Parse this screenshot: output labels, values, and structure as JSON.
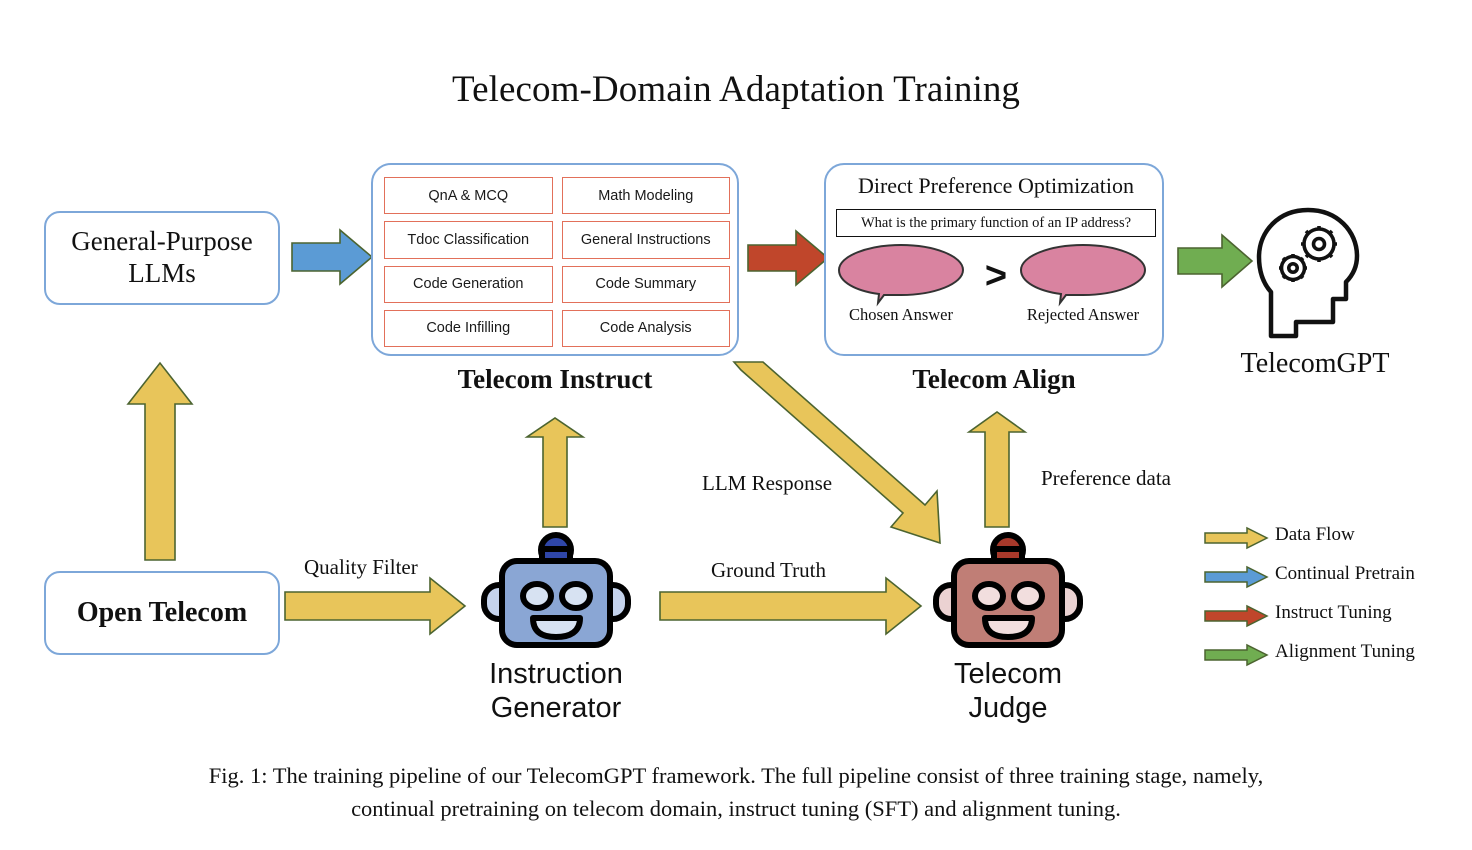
{
  "figure": {
    "title": "Telecom-Domain Adaptation Training",
    "caption_line1": "Fig. 1: The training pipeline of our TelecomGPT framework. The full pipeline consist of three training stage, namely,",
    "caption_line2": "continual pretraining on telecom domain, instruct tuning (SFT) and alignment tuning."
  },
  "nodes": {
    "general_purpose_llms_line1": "General-Purpose",
    "general_purpose_llms_line2": "LLMs",
    "open_telecom": "Open Telecom",
    "telecomgpt_label": "TelecomGPT",
    "instruction_generator_line1": "Instruction",
    "instruction_generator_line2": "Generator",
    "telecom_judge_line1": "Telecom",
    "telecom_judge_line2": "Judge"
  },
  "stages": {
    "instruct_caption": "Telecom Instruct",
    "align_caption": "Telecom Align"
  },
  "instruct_tasks": [
    "QnA & MCQ",
    "Math Modeling",
    "Tdoc Classification",
    "General Instructions",
    "Code Generation",
    "Code Summary",
    "Code Infilling",
    "Code Analysis"
  ],
  "dpo": {
    "title": "Direct Preference Optimization",
    "prompt": "What is the primary function of an IP address?",
    "comparison_operator": ">",
    "chosen_label": "Chosen Answer",
    "rejected_label": "Rejected Answer"
  },
  "edge_labels": {
    "quality_filter": "Quality Filter",
    "ground_truth": "Ground Truth",
    "llm_response": "LLM Response",
    "preference_data": "Preference data"
  },
  "legend": [
    {
      "label": "Data Flow",
      "color": "#E8C55A"
    },
    {
      "label": "Continual Pretrain",
      "color": "#5B9BD5"
    },
    {
      "label": "Instruct Tuning",
      "color": "#C0462B"
    },
    {
      "label": "Alignment Tuning",
      "color": "#70AD51"
    }
  ],
  "colors": {
    "data_flow": "#E8C55A",
    "continual_pretrain": "#5B9BD5",
    "instruct_tuning": "#C0462B",
    "alignment_tuning": "#70AD51",
    "arrow_outline": "#4C6430",
    "box_border": "#7da7d9",
    "task_border": "#e2705a",
    "bubble_fill": "#D983A0",
    "robot_blue": "#8AA6D4",
    "robot_red": "#C07E76"
  }
}
